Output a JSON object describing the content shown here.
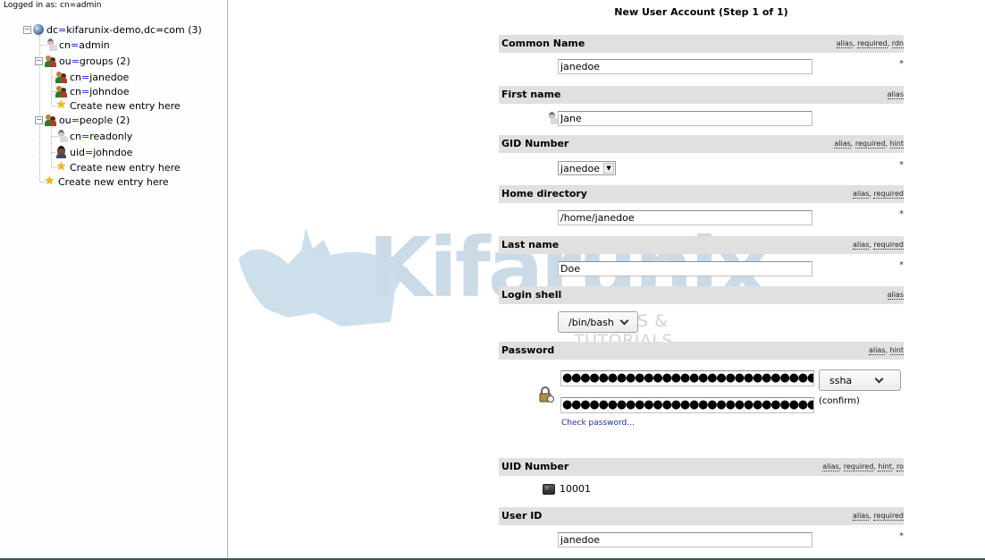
{
  "login_status": "Logged in as: cn=admin",
  "tree": {
    "root": {
      "attr": "dc",
      "value": "kifarunix-demo,dc=com (3)",
      "icon": "globe-icon"
    },
    "nodes": [
      {
        "attr": "cn",
        "value": "admin",
        "icon": "person-icon"
      },
      {
        "attr": "ou",
        "value": "groups (2)",
        "icon": "group-icon"
      },
      {
        "attr": "cn",
        "value": "janedoe",
        "icon": "group-icon"
      },
      {
        "attr": "cn",
        "value": "johndoe",
        "icon": "group-icon"
      },
      {
        "label": "Create new entry here",
        "icon": "star-icon"
      },
      {
        "attr": "ou",
        "value": "people (2)",
        "icon": "group-icon"
      },
      {
        "attr": "cn",
        "value": "readonly",
        "icon": "person-icon"
      },
      {
        "attr": "uid",
        "value": "johndoe",
        "icon": "user-dark-icon"
      },
      {
        "label": "Create new entry here",
        "icon": "star-icon"
      },
      {
        "label": "Create new entry here",
        "icon": "star-icon"
      }
    ],
    "expander_symbol": "−",
    "eq": "="
  },
  "form": {
    "title": "New User Account (Step 1 of 1)",
    "required_mark": "*",
    "fields": {
      "common_name": {
        "label": "Common Name",
        "hints": [
          "alias",
          "required",
          "rdn"
        ],
        "value": "janedoe"
      },
      "first_name": {
        "label": "First name",
        "hints": [
          "alias"
        ],
        "value": "Jane"
      },
      "gid_number": {
        "label": "GID Number",
        "hints": [
          "alias",
          "required",
          "hint"
        ],
        "selected": "janedoe"
      },
      "home_directory": {
        "label": "Home directory",
        "hints": [
          "alias",
          "required"
        ],
        "value": "/home/janedoe"
      },
      "last_name": {
        "label": "Last name",
        "hints": [
          "alias",
          "required"
        ],
        "value": "Doe"
      },
      "login_shell": {
        "label": "Login shell",
        "hints": [
          "alias"
        ],
        "selected": "/bin/bash"
      },
      "password": {
        "label": "Password",
        "hints": [
          "alias",
          "hint"
        ],
        "masked": "●●●●●●●●●●●●●●●●●●●●●●●●●●●●●●●●●●●●●",
        "hash_selected": "ssha",
        "confirm_label": "(confirm)",
        "check_link": "Check password..."
      },
      "uid_number": {
        "label": "UID Number",
        "hints": [
          "alias",
          "required",
          "hint",
          "ro"
        ],
        "value": "10001"
      },
      "user_id": {
        "label": "User ID",
        "hints": [
          "alias",
          "required"
        ],
        "value": "janedoe"
      }
    }
  },
  "watermark": {
    "brand": "Kifarunix",
    "tagline": "NIX TIPS & TUTORIALS"
  }
}
